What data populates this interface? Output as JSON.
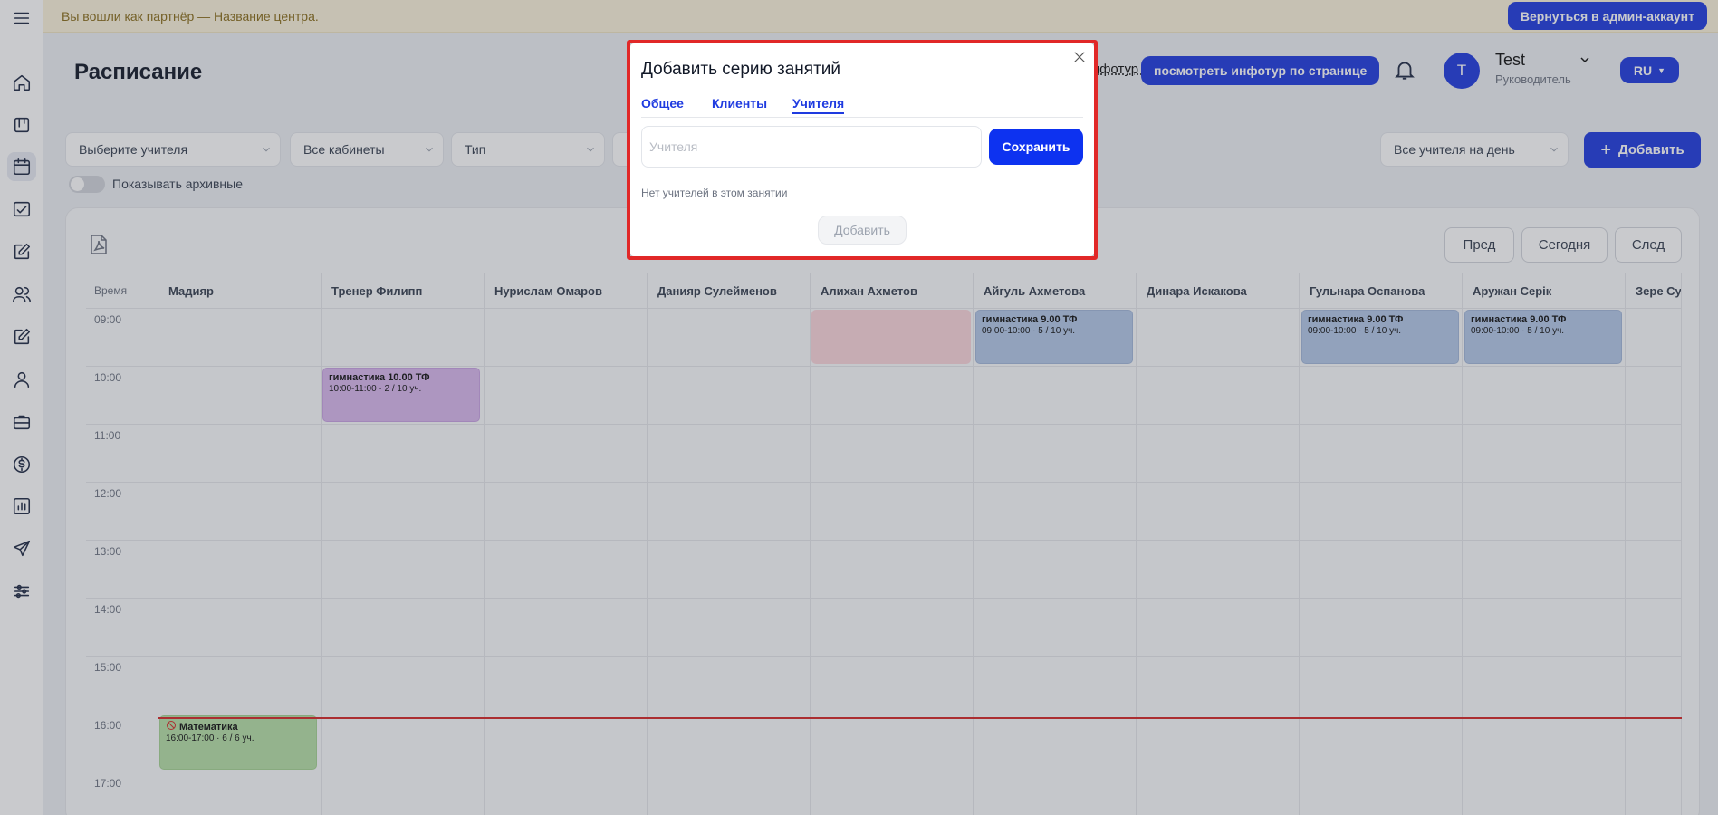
{
  "banner": {
    "text": "Вы вошли как партнёр — Название центра.",
    "back_button": "Вернуться в админ-аккаунт"
  },
  "header": {
    "title": "Расписание",
    "tour_link_partial": "Инфотур по странице",
    "tour_button": "посмотреть инфотур по странице",
    "user": {
      "avatar_letter": "T",
      "name": "Test",
      "role": "Руководитель"
    },
    "language": "RU"
  },
  "filters": {
    "teacher_select": "Выберите учителя",
    "rooms_select": "Все кабинеты",
    "type_select": "Тип",
    "archived_toggle_label": "Показывать архивные",
    "day_teachers_select": "Все учителя на день",
    "add_button": "Добавить"
  },
  "calendar": {
    "nav": {
      "prev": "Пред",
      "today": "Сегодня",
      "next": "След"
    },
    "time_header": "Время",
    "columns": [
      "Мадияр",
      "Тренер Филипп",
      "Нурислам Омаров",
      "Данияр Сулейменов",
      "Алихан Ахметов",
      "Айгуль Ахметова",
      "Динара Искакова",
      "Гульнара Оспанова",
      "Аружан Серік",
      "Зере Сул"
    ],
    "times": [
      "09:00",
      "10:00",
      "11:00",
      "12:00",
      "13:00",
      "14:00",
      "15:00",
      "16:00",
      "17:00"
    ],
    "events": [
      {
        "title": "гимнастика 9.00 ТФ",
        "subtitle": "09:00-10:00 · 5 / 10 уч.",
        "column": 5,
        "color": "#b3c8e8"
      },
      {
        "title": "гимнастика 9.00 ТФ",
        "subtitle": "09:00-10:00 · 5 / 10 уч.",
        "column": 7,
        "color": "#b3c8e8"
      },
      {
        "title": "гимнастика 9.00 ТФ",
        "subtitle": "09:00-10:00 · 5 / 10 уч.",
        "column": 8,
        "color": "#b3c8e8"
      },
      {
        "title": "гимнастика 10.00 ТФ",
        "subtitle": "10:00-11:00 · 2 / 10 уч.",
        "column": 1,
        "color": "#d8b7ee"
      },
      {
        "title": "Математика",
        "subtitle": "16:00-17:00 · 6 / 6 уч.",
        "column": 0,
        "color": "#b6e0a7"
      }
    ]
  },
  "modal": {
    "title": "Добавить серию занятий",
    "tabs": [
      "Общее",
      "Клиенты",
      "Учителя"
    ],
    "active_tab": "Учителя",
    "teachers_placeholder": "Учителя",
    "save_button": "Сохранить",
    "empty_text": "Нет учителей в этом занятии",
    "add_button": "Добавить"
  }
}
